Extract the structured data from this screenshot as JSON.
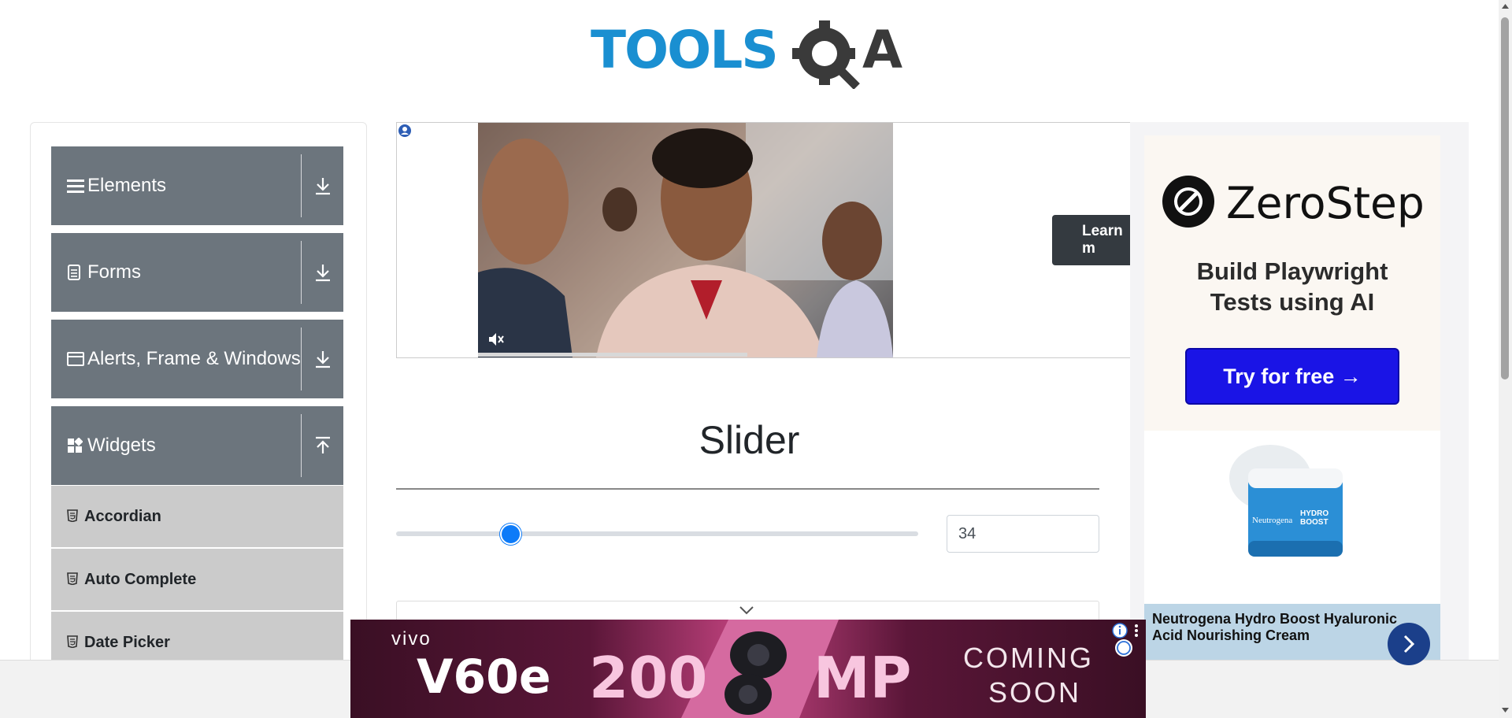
{
  "logo": {
    "part1": "TOOLS",
    "part2": "A"
  },
  "sidebar": {
    "groups": [
      {
        "label": "Elements",
        "icon": "hamburger-icon"
      },
      {
        "label": "Forms",
        "icon": "document-icon"
      },
      {
        "label": "Alerts, Frame & Windows",
        "icon": "window-icon"
      },
      {
        "label": "Widgets",
        "icon": "widgets-icon"
      }
    ],
    "sub_items": [
      {
        "label": "Accordian",
        "icon": "html5-icon"
      },
      {
        "label": "Auto Complete",
        "icon": "html5-icon"
      },
      {
        "label": "Date Picker",
        "icon": "html5-icon"
      }
    ]
  },
  "video_ad": {
    "learn_more": "Learn m"
  },
  "main": {
    "title": "Slider",
    "slider_value": "34"
  },
  "slider": {
    "fraction": 0.22
  },
  "right_ad": {
    "brand": "ZeroStep",
    "headline_1": "Build Playwright",
    "headline_2": "Tests using AI",
    "cta": "Try for free →",
    "product_line1": "Neutrogena Hydro Boost Hyaluronic",
    "product_line2": "Acid Nourishing Cream",
    "cream_label_1": "Neutrogena",
    "cream_label_2": "HYDRO",
    "cream_label_3": "BOOST"
  },
  "bottom_ad": {
    "brand": "vivo",
    "model": "V60e",
    "megapixels": "200",
    "mp": "MP",
    "coming": "COMING",
    "soon": "SOON"
  },
  "colors": {
    "accent": "#0d7bf8",
    "sidebar_group": "#6c757d",
    "sidebar_sub": "#cbcbcb",
    "cta_blue": "#1a14e6"
  }
}
